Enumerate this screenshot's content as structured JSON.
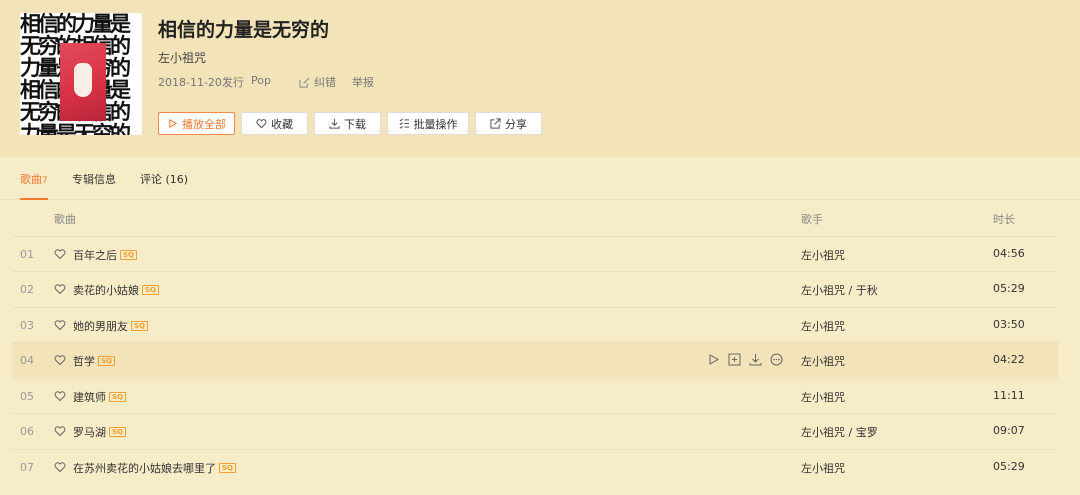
{
  "album": {
    "title": "相信的力量是无穷的",
    "artist": "左小祖咒",
    "release": "2018-11-20发行",
    "genre": "Pop",
    "correct_label": "纠错",
    "report_label": "举报",
    "cover_text": "相信的力量是\n无穷的相信的\n力量是无穷的\n相信的力量是\n无穷的相信的\n力量是无穷的"
  },
  "buttons": {
    "play_all": "播放全部",
    "favorite": "收藏",
    "download": "下载",
    "batch": "批量操作",
    "share": "分享"
  },
  "tabs": {
    "songs": "歌曲",
    "songs_count": "7",
    "info": "专辑信息",
    "comments": "评论 (16)"
  },
  "columns": {
    "song": "歌曲",
    "artist": "歌手",
    "duration": "时长"
  },
  "badge": "SQ",
  "songs": [
    {
      "num": "01",
      "title": "百年之后",
      "artist": "左小祖咒",
      "duration": "04:56"
    },
    {
      "num": "02",
      "title": "卖花的小姑娘",
      "artist": "左小祖咒 / 于秋",
      "duration": "05:29"
    },
    {
      "num": "03",
      "title": "她的男朋友",
      "artist": "左小祖咒",
      "duration": "03:50"
    },
    {
      "num": "04",
      "title": "哲学",
      "artist": "左小祖咒",
      "duration": "04:22"
    },
    {
      "num": "05",
      "title": "建筑师",
      "artist": "左小祖咒",
      "duration": "11:11"
    },
    {
      "num": "06",
      "title": "罗马湖",
      "artist": "左小祖咒 / 宝罗",
      "duration": "09:07"
    },
    {
      "num": "07",
      "title": "在苏州卖花的小姑娘去哪里了",
      "artist": "左小祖咒",
      "duration": "05:29"
    }
  ],
  "colors": {
    "accent": "#f07a30",
    "header_bg": "#f2e3b8",
    "page_bg": "#f7ecc8",
    "sq_badge": "#f0a030"
  }
}
